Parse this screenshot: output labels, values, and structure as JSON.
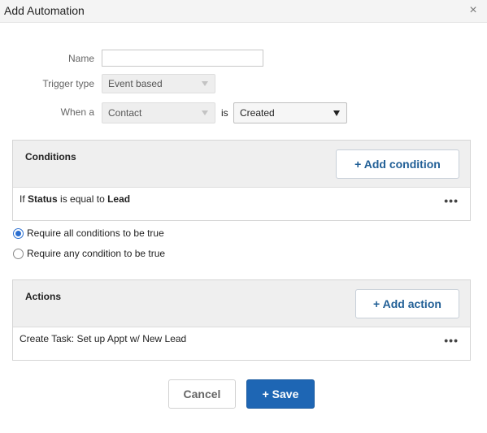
{
  "window": {
    "title": "Add Automation",
    "close_glyph": "×"
  },
  "form": {
    "name_label": "Name",
    "name_value": "",
    "trigger_label": "Trigger type",
    "trigger_value": "Event based",
    "when_label": "When a",
    "when_value": "Contact",
    "is_label": "is",
    "event_value": "Created"
  },
  "conditions": {
    "title": "Conditions",
    "add_label": "+ Add condition",
    "rows": [
      {
        "prefix": "If ",
        "field": "Status",
        "operator": " is equal to ",
        "value": "Lead"
      }
    ],
    "more_glyph": "•••"
  },
  "match": {
    "options": [
      {
        "label": "Require all conditions to be true",
        "selected": true
      },
      {
        "label": "Require any condition to be true",
        "selected": false
      }
    ]
  },
  "actions": {
    "title": "Actions",
    "add_label": "+ Add action",
    "rows": [
      {
        "text": "Create Task: Set up Appt w/ New Lead"
      }
    ],
    "more_glyph": "•••"
  },
  "footer": {
    "cancel_label": "Cancel",
    "save_label": "+ Save"
  },
  "colors": {
    "accent": "#1e66b4",
    "link": "#215f96",
    "radio": "#2a6ed0"
  },
  "icons": {
    "close": "close-icon",
    "caret": "caret-down-icon",
    "more": "more-icon"
  }
}
